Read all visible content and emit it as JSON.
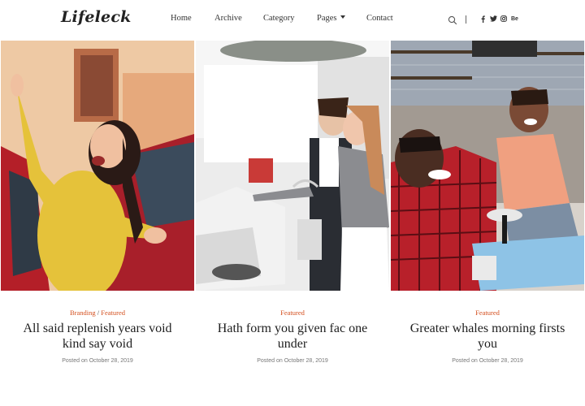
{
  "header": {
    "logo": "Lifeleck",
    "nav": [
      {
        "label": "Home"
      },
      {
        "label": "Archive"
      },
      {
        "label": "Category"
      },
      {
        "label": "Pages"
      },
      {
        "label": "Contact"
      }
    ],
    "social_behance": "Be",
    "icons": [
      "search-icon",
      "facebook-icon",
      "twitter-icon",
      "instagram-icon",
      "behance-icon"
    ]
  },
  "posts": [
    {
      "categories": [
        "Branding",
        "Featured"
      ],
      "separator": "/",
      "title": "All said replenish years void kind say void",
      "date": "Posted on October 28, 2019",
      "image": "woman-yellow-sweater-by-car"
    },
    {
      "categories": [
        "Featured"
      ],
      "title": "Hath form you given fac one under",
      "date": "Posted on October 28, 2019",
      "image": "couple-in-car-showroom"
    },
    {
      "categories": [
        "Featured"
      ],
      "title": "Greater whales morning firsts you",
      "date": "Posted on October 28, 2019",
      "image": "father-and-son-toy-car"
    }
  ],
  "colors": {
    "accent": "#d4501f",
    "text": "#1e1e1e",
    "muted": "#777777"
  }
}
